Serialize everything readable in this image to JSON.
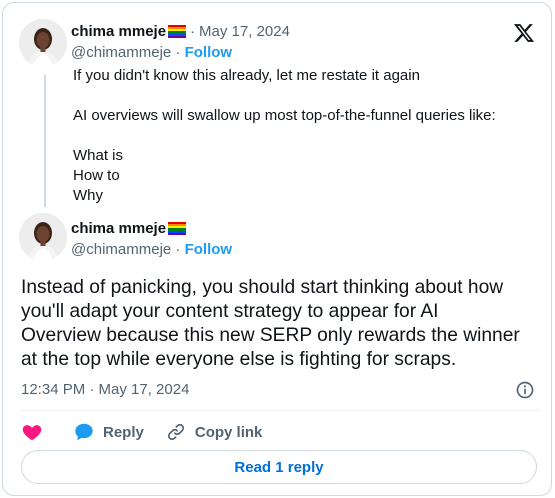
{
  "quoted_tweet": {
    "author_name": "chima mmeje",
    "author_flag": "rainbow-flag-emoji",
    "separator": "·",
    "date": "May 17, 2024",
    "handle": "@chimammeje",
    "follow_label": "Follow",
    "lines": [
      "If you didn't know this already, let me restate it again",
      "",
      "AI overviews will swallow up most top-of-the-funnel queries like:",
      "",
      "What is",
      "How to",
      "Why"
    ]
  },
  "tweet": {
    "author_name": "chima mmeje",
    "author_flag": "rainbow-flag-emoji",
    "handle": "@chimammeje",
    "separator": "·",
    "follow_label": "Follow",
    "text_lines": [
      "Instead of panicking, you should start thinking about how",
      "you'll adapt your content strategy to appear for AI",
      "Overview because this new SERP only rewards the winner",
      "at the top while everyone else is fighting for scraps."
    ],
    "timestamp": "12:34 PM · May 17, 2024"
  },
  "actions": {
    "reply_label": "Reply",
    "copy_link_label": "Copy link"
  },
  "read_replies_label": "Read 1 reply",
  "icons": {
    "brand": "x-logo-icon",
    "like": "heart-icon",
    "reply": "speech-bubble-icon",
    "copy": "link-icon",
    "info": "info-icon"
  },
  "colors": {
    "text": "#0f1419",
    "muted": "#536471",
    "follow": "#1d9bf0",
    "like": "#f91880",
    "reply_icon": "#1d9bf0",
    "read_reply": "#006fd6",
    "border": "#cfd9de"
  }
}
